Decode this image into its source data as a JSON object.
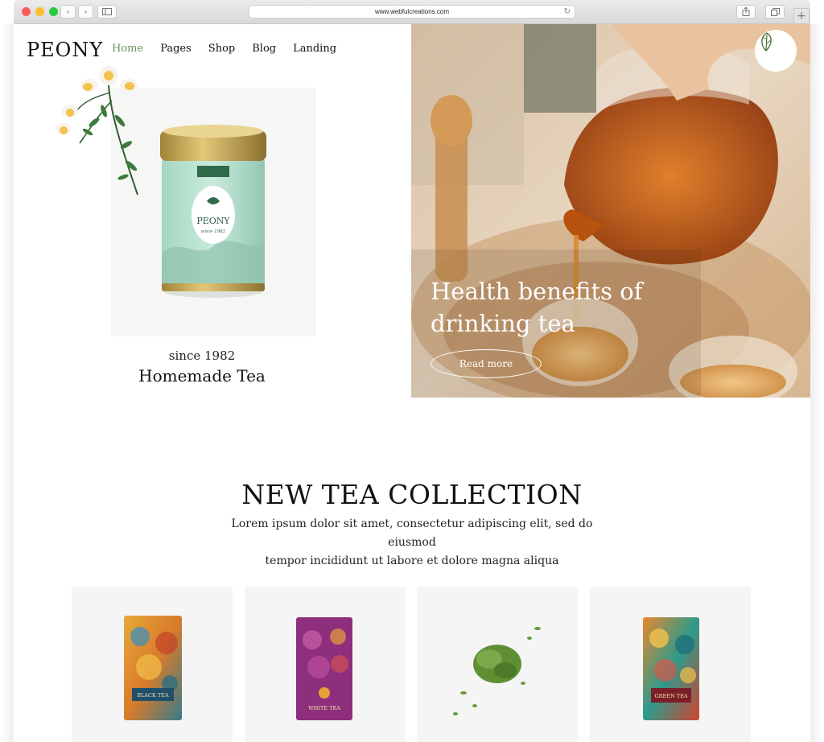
{
  "browser": {
    "url": "www.webfulcreations.com",
    "back_icon": "chevron-left-icon",
    "forward_icon": "chevron-right-icon",
    "sidebar_icon": "sidebar-icon",
    "reload_icon": "reload-icon",
    "share_icon": "share-icon",
    "tabs_icon": "tabs-icon",
    "new_tab_icon": "plus-icon"
  },
  "header": {
    "logo": "PEONY",
    "nav": [
      {
        "label": "Home",
        "active": true
      },
      {
        "label": "Pages",
        "active": false
      },
      {
        "label": "Shop",
        "active": false
      },
      {
        "label": "Blog",
        "active": false
      },
      {
        "label": "Landing",
        "active": false
      }
    ]
  },
  "intro": {
    "since": "since 1982",
    "title": "Homemade Tea",
    "tin_brand": "PEONY",
    "tin_tagline": "since 1982"
  },
  "hero": {
    "title_line1": "Health benefits of",
    "title_line2": "drinking tea",
    "button": "Read more",
    "badge_icon": "leaf-icon"
  },
  "collection": {
    "title": "NEW TEA COLLECTION",
    "description_line1": "Lorem ipsum dolor sit amet, consectetur adipiscing elit, sed do eiusmod",
    "description_line2": "tempor incididunt ut labore et dolore magna aliqua",
    "products": [
      {
        "label": "BLACK TEA"
      },
      {
        "label": "WHITE TEA"
      },
      {
        "label": ""
      },
      {
        "label": "GREEN TEA"
      }
    ]
  },
  "colors": {
    "accent": "#6e8f5a",
    "text": "#111111",
    "card_bg": "#f5f5f5"
  }
}
